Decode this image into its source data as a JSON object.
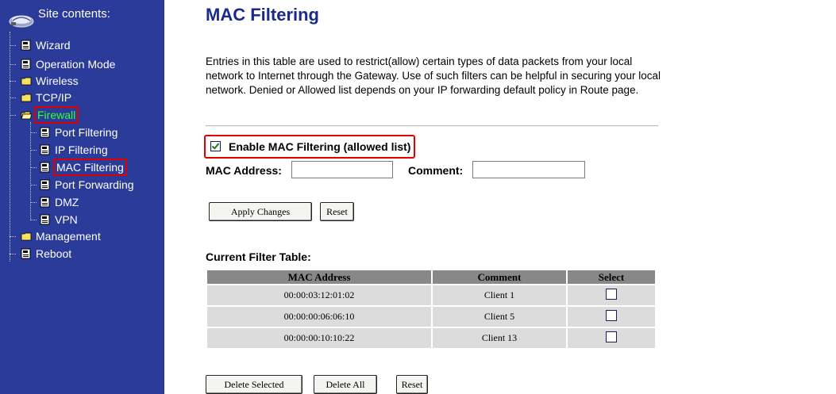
{
  "sidebar": {
    "title": "Site contents:",
    "items": [
      {
        "label": "Wizard"
      },
      {
        "label": "Operation Mode"
      },
      {
        "label": "Wireless"
      },
      {
        "label": "TCP/IP"
      },
      {
        "label": "Firewall"
      },
      {
        "label": "Port Filtering"
      },
      {
        "label": "IP Filtering"
      },
      {
        "label": "MAC Filtering"
      },
      {
        "label": "Port Forwarding"
      },
      {
        "label": "DMZ"
      },
      {
        "label": "VPN"
      },
      {
        "label": "Management"
      },
      {
        "label": "Reboot"
      }
    ]
  },
  "page": {
    "title": "MAC Filtering",
    "description": "Entries in this table are used to restrict(allow) certain types of data packets from your local network to Internet through the Gateway. Use of such filters can be helpful in securing your local network. Denied or Allowed list depends on your IP forwarding default policy in Route page."
  },
  "form": {
    "enable_label": "Enable MAC Filtering (allowed list)",
    "enable_checked": true,
    "mac_label": "MAC Address:",
    "mac_value": "",
    "comment_label": "Comment:",
    "comment_value": "",
    "apply_label": "Apply Changes",
    "reset_label": "Reset"
  },
  "table": {
    "title": "Current Filter Table:",
    "columns": [
      "MAC Address",
      "Comment",
      "Select"
    ],
    "rows": [
      {
        "mac": "00:00:03:12:01:02",
        "comment": "Client 1"
      },
      {
        "mac": "00:00:00:06:06:10",
        "comment": "Client 5"
      },
      {
        "mac": "00:00:00:10:10:22",
        "comment": "Client 13"
      }
    ]
  },
  "actions": {
    "delete_selected": "Delete Selected",
    "delete_all": "Delete All",
    "reset": "Reset"
  },
  "colors": {
    "sidebar_bg": "#2b3b99",
    "title": "#1a2a8c",
    "highlight": "#e00000",
    "firewall_text": "#33ff33",
    "table_header": "#888888",
    "table_cell": "#dcdcdc"
  }
}
